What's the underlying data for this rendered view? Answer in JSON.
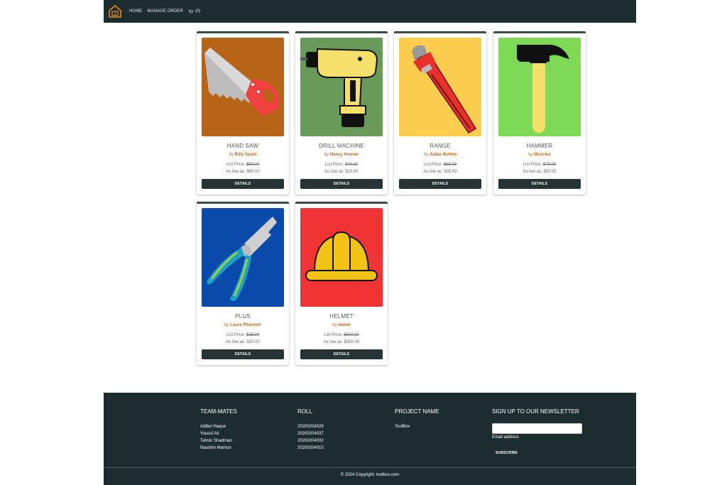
{
  "nav": {
    "links": [
      "HOME",
      "MANAGE ORDER"
    ],
    "cart_count": "(0)"
  },
  "products": [
    {
      "name": "HAND SAW",
      "by": "by",
      "author": "Billy Spark",
      "list_label": "List Price:",
      "list_price": "$99.00",
      "low_label": "As low as:",
      "low_price": "$80.00",
      "button": "DETAILS",
      "bg": "#b86418",
      "icon": "hand-saw-icon"
    },
    {
      "name": "DRILL MACHINE",
      "by": "by",
      "author": "Nancy Hoover",
      "list_label": "List Price:",
      "list_price": "$40.00",
      "low_label": "As low as:",
      "low_price": "$20.00",
      "button": "DETAILS",
      "bg": "#6a9a5a",
      "icon": "drill-icon"
    },
    {
      "name": "RANGE",
      "by": "by",
      "author": "Julian Button",
      "list_label": "List Price:",
      "list_price": "$55.00",
      "low_label": "As low as:",
      "low_price": "$35.00",
      "button": "DETAILS",
      "bg": "#fbcd4f",
      "icon": "wrench-icon"
    },
    {
      "name": "HAMMER",
      "by": "by",
      "author": "Muscles",
      "list_label": "List Price:",
      "list_price": "$70.00",
      "low_label": "As low as:",
      "low_price": "$55.00",
      "button": "DETAILS",
      "bg": "#7ed957",
      "icon": "hammer-icon"
    },
    {
      "name": "PLUS",
      "by": "by",
      "author": "Laura Phantom",
      "list_label": "List Price:",
      "list_price": "$25.00",
      "low_label": "As low as:",
      "low_price": "$20.00",
      "button": "DETAILS",
      "bg": "#0a4aab",
      "icon": "pliers-icon"
    },
    {
      "name": "HELMET",
      "by": "by",
      "author": "daniel",
      "list_label": "List Price:",
      "list_price": "$500.00",
      "low_label": "As low as:",
      "low_price": "$350.00",
      "button": "DETAILS",
      "bg": "#f03436",
      "icon": "helmet-icon"
    }
  ],
  "footer": {
    "team_title": "TEAM-MATES",
    "team": [
      "Adibul Haque",
      "Yousuf Ali",
      "Tahsin Shadman",
      "Naushin Mamun"
    ],
    "roll_title": "ROLL",
    "rolls": [
      "20200204029",
      "20200204037",
      "20200204032",
      "20200204010"
    ],
    "project_title": "PROJECT NAME",
    "project": "ToolBox",
    "newsletter_title": "SIGN UP TO OUR NEWSLETTER",
    "email_label": "Email address",
    "subscribe": "SUBSCRIBE",
    "copyright": "© 2024 Copyright: toolbox.com"
  }
}
